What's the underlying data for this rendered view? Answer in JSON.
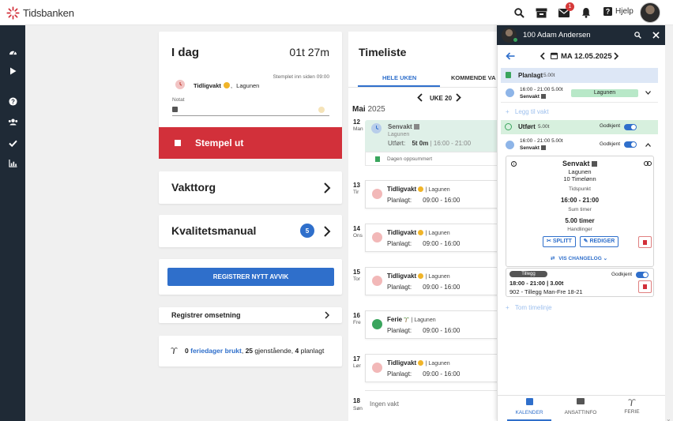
{
  "app": {
    "brand": "Tidsbanken",
    "help_label": "Hjelp",
    "mail_count": "1"
  },
  "today": {
    "title": "I dag",
    "elapsed": "01t 27m",
    "stamped_since": "Stemplet inn siden 09:00",
    "shift": "Tidligvakt",
    "shift_sep": ",",
    "location": "Lagunen",
    "note_label": "Notat",
    "stamp_out": "Stempel ut"
  },
  "cards": {
    "vakttorg": "Vakttorg",
    "kvalitet": "Kvalitetsmanual",
    "kvalitet_count": "5",
    "avvik_button": "REGISTRER NYTT AVVIK",
    "omsetning": "Registrer omsetning"
  },
  "vacation": {
    "used": "0",
    "used_label": "feriedager brukt",
    "remaining": "25",
    "remaining_label": "gjenstående,",
    "planned": "4",
    "planned_label": "planlagt",
    "comma": ","
  },
  "timeliste": {
    "title": "Timeliste",
    "tab_week": "HELE UKEN",
    "tab_upcoming": "KOMMENDE VA",
    "week_label": "UKE 20",
    "month": "Mai",
    "year": "2025",
    "days": [
      {
        "num": "12",
        "name": "Man",
        "title": "Senvakt",
        "loc": "Lagunen",
        "prefix": "Utført:",
        "value": "5t 0m",
        "time": "| 16:00 - 21:00",
        "footer": "Dagen oppsummert"
      },
      {
        "num": "13",
        "name": "Tir",
        "title": "Tidligvakt",
        "loc": "| Lagunen",
        "prefix": "Planlagt:",
        "time": "09:00 - 16:00"
      },
      {
        "num": "14",
        "name": "Ons",
        "title": "Tidligvakt",
        "loc": "| Lagunen",
        "prefix": "Planlagt:",
        "time": "09:00 - 16:00"
      },
      {
        "num": "15",
        "name": "Tor",
        "title": "Tidligvakt",
        "loc": "| Lagunen",
        "prefix": "Planlagt:",
        "time": "09:00 - 16:00"
      },
      {
        "num": "16",
        "name": "Fre",
        "title": "Ferie",
        "loc": "| Lagunen",
        "prefix": "Planlagt:",
        "time": "09:00 - 16:00"
      },
      {
        "num": "17",
        "name": "Lør",
        "title": "Tidligvakt",
        "loc": "| Lagunen",
        "prefix": "Planlagt:",
        "time": "09:00 - 16:00"
      },
      {
        "num": "18",
        "name": "Søn",
        "empty": "Ingen vakt"
      }
    ]
  },
  "panel": {
    "employee": "100 Adam Andersen",
    "date": "MA 12.05.2025",
    "planned_label": "Planlagt",
    "planned_hours": "5.00t",
    "planned_time": "16:00 - 21:00 5.00t",
    "planned_name": "Senvakt",
    "planned_tag": "Lagunen",
    "add_shift": "Legg til vakt",
    "done_label": "Utført",
    "done_hours": "5.00t",
    "approved": "Godkjent",
    "done_time": "16:00 - 21:00 5.00t",
    "done_name": "Senvakt",
    "detail_title": "Senvakt",
    "detail_loc": "Lagunen",
    "detail_pay": "10 Timelønn",
    "tp_label": "Tidspunkt",
    "tp_value": "16:00 - 21:00",
    "sum_label": "Sum timer",
    "sum_value": "5.00 timer",
    "actions_label": "Handlinger",
    "split_btn": "SPLITT",
    "edit_btn": "REDIGER",
    "changelog": "VIS CHANGELOG",
    "addon_tag": "Tillegg",
    "addon_approved": "Godkjent",
    "addon_time": "18:00 - 21:00 | 3.00t",
    "addon_desc": "902 - Tillegg Man-Fre 18-21",
    "empty_line": "Tom timelinje",
    "nav_calendar": "KALENDER",
    "nav_info": "ANSATTINFO",
    "nav_vacation": "FERIE"
  },
  "colors": {
    "accent": "#2f6fcb",
    "danger": "#d2303a",
    "nav": "#1f2a36",
    "ok": "#3aa55d",
    "planned_bg": "#dde7f6",
    "done_bg": "#d7f0de"
  }
}
